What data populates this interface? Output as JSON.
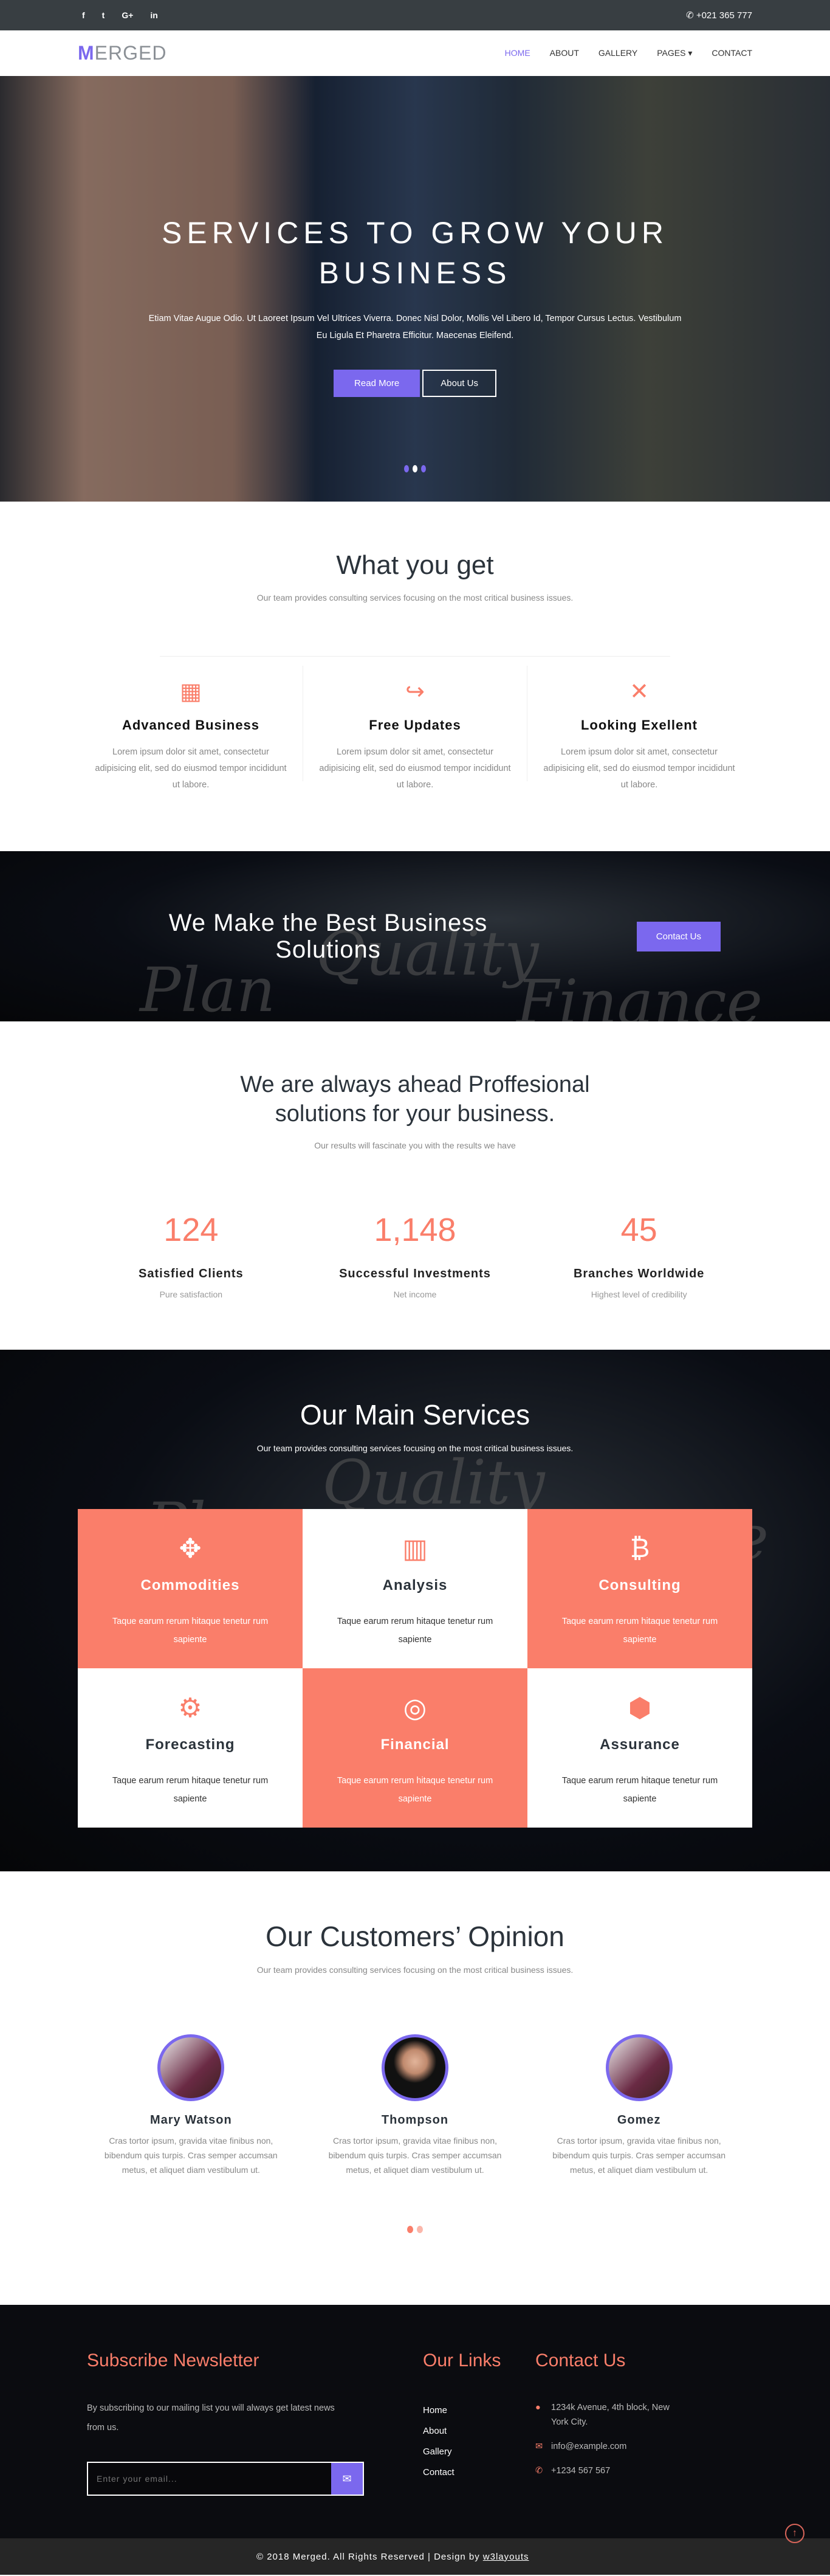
{
  "topbar": {
    "social": [
      "f",
      "t",
      "G+",
      "in"
    ],
    "phone": "+021 365 777"
  },
  "nav": {
    "logo_first": "M",
    "logo_rest": "ERGED",
    "items": [
      "HOME",
      "ABOUT",
      "GALLERY",
      "PAGES ▾",
      "CONTACT"
    ]
  },
  "hero": {
    "title": "SERVICES TO GROW YOUR BUSINESS",
    "text": "Etiam Vitae Augue Odio. Ut Laoreet Ipsum Vel Ultrices Viverra. Donec Nisl Dolor, Mollis Vel Libero Id, Tempor Cursus Lectus. Vestibulum Eu Ligula Et Pharetra Efficitur. Maecenas Eleifend.",
    "read_more": "Read More",
    "about_us": "About Us",
    "active_slide": 2,
    "slide_count": 3
  },
  "whatyouget": {
    "title": "What you get",
    "subtitle": "Our team provides consulting services focusing on the most critical business issues.",
    "features": [
      {
        "icon": "th-large-icon",
        "glyph": "▦",
        "title": "Advanced Business",
        "text": "Lorem ipsum dolor sit amet, consectetur adipisicing elit, sed do eiusmod tempor incididunt ut labore."
      },
      {
        "icon": "share-square-icon",
        "glyph": "↪",
        "title": "Free Updates",
        "text": "Lorem ipsum dolor sit amet, consectetur adipisicing elit, sed do eiusmod tempor incididunt ut labore."
      },
      {
        "icon": "expand-arrows-icon",
        "glyph": "✕",
        "title": "Looking Exellent",
        "text": "Lorem ipsum dolor sit amet, consectetur adipisicing elit, sed do eiusmod tempor incididunt ut labore."
      }
    ]
  },
  "banner": {
    "title": "We Make the Best Business Solutions",
    "button": "Contact Us",
    "bg_words": [
      "Plan",
      "Quality",
      "Finance"
    ]
  },
  "stats": {
    "title": "We are always ahead Proffesional solutions for your business.",
    "subtitle": "Our results will fascinate you with the results we have",
    "items": [
      {
        "value": "124",
        "label": "Satisfied Clients",
        "sub": "Pure satisfaction"
      },
      {
        "value": "1,148",
        "label": "Successful Investments",
        "sub": "Net income"
      },
      {
        "value": "45",
        "label": "Branches Worldwide",
        "sub": "Highest level of credibility"
      }
    ]
  },
  "services": {
    "title": "Our Main Services",
    "subtitle": "Our team provides consulting services focusing on the most critical business issues.",
    "items": [
      {
        "icon": "arrows-icon",
        "glyph": "✥",
        "title": "Commodities",
        "text": "Taque earum rerum hitaque tenetur rum sapiente"
      },
      {
        "icon": "bar-chart-icon",
        "glyph": "📊",
        "title": "Analysis",
        "text": "Taque earum rerum hitaque tenetur rum sapiente"
      },
      {
        "icon": "bitcoin-icon",
        "glyph": "₿",
        "title": "Consulting",
        "text": "Taque earum rerum hitaque tenetur rum sapiente"
      },
      {
        "icon": "gears-icon",
        "glyph": "⚙",
        "title": "Forecasting",
        "text": "Taque earum rerum hitaque tenetur rum sapiente"
      },
      {
        "icon": "bullseye-icon",
        "glyph": "◎",
        "title": "Financial",
        "text": "Taque earum rerum hitaque tenetur rum sapiente"
      },
      {
        "icon": "cubes-icon",
        "glyph": "⬢",
        "title": "Assurance",
        "text": "Taque earum rerum hitaque tenetur rum sapiente"
      }
    ]
  },
  "opinion": {
    "title": "Our Customers’ Opinion",
    "subtitle": "Our team provides consulting services focusing on the most critical business issues.",
    "people": [
      {
        "name": "Mary Watson",
        "text": "Cras tortor ipsum, gravida vitae finibus non, bibendum quis turpis. Cras semper accumsan metus, et aliquet diam vestibulum ut."
      },
      {
        "name": "Thompson",
        "text": "Cras tortor ipsum, gravida vitae finibus non, bibendum quis turpis. Cras semper accumsan metus, et aliquet diam vestibulum ut."
      },
      {
        "name": "Gomez",
        "text": "Cras tortor ipsum, gravida vitae finibus non, bibendum quis turpis. Cras semper accumsan metus, et aliquet diam vestibulum ut."
      }
    ]
  },
  "footer": {
    "newsletter_title": "Subscribe Newsletter",
    "newsletter_text": "By subscribing to our mailing list you will always get latest news from us.",
    "email_placeholder": "Enter your email...",
    "links_title": "Our Links",
    "links": [
      "Home",
      "About",
      "Gallery",
      "Contact"
    ],
    "contact_title": "Contact Us",
    "address": "1234k Avenue, 4th block, New York City.",
    "email": "info@example.com",
    "phone": "+1234 567 567",
    "copyright": "© 2018 Merged. All Rights Reserved | Design by",
    "designer": "w3layouts"
  },
  "colors": {
    "accent": "#7b68ee",
    "coral": "#fa7e6a",
    "topbar": "#383e42",
    "footer": "#0b0c10"
  }
}
